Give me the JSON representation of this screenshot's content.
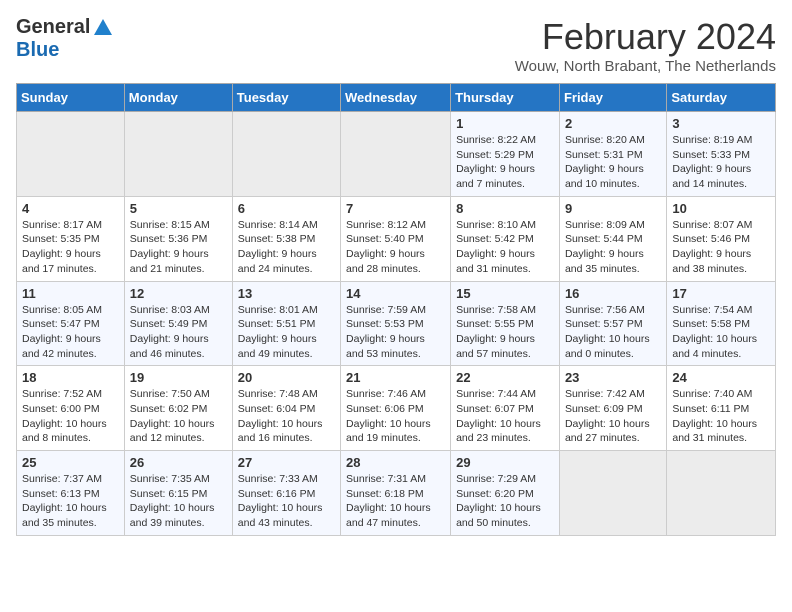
{
  "header": {
    "logo_general": "General",
    "logo_blue": "Blue",
    "month_title": "February 2024",
    "subtitle": "Wouw, North Brabant, The Netherlands"
  },
  "days_of_week": [
    "Sunday",
    "Monday",
    "Tuesday",
    "Wednesday",
    "Thursday",
    "Friday",
    "Saturday"
  ],
  "weeks": [
    [
      {
        "day": "",
        "info": ""
      },
      {
        "day": "",
        "info": ""
      },
      {
        "day": "",
        "info": ""
      },
      {
        "day": "",
        "info": ""
      },
      {
        "day": "1",
        "info": "Sunrise: 8:22 AM\nSunset: 5:29 PM\nDaylight: 9 hours and 7 minutes."
      },
      {
        "day": "2",
        "info": "Sunrise: 8:20 AM\nSunset: 5:31 PM\nDaylight: 9 hours and 10 minutes."
      },
      {
        "day": "3",
        "info": "Sunrise: 8:19 AM\nSunset: 5:33 PM\nDaylight: 9 hours and 14 minutes."
      }
    ],
    [
      {
        "day": "4",
        "info": "Sunrise: 8:17 AM\nSunset: 5:35 PM\nDaylight: 9 hours and 17 minutes."
      },
      {
        "day": "5",
        "info": "Sunrise: 8:15 AM\nSunset: 5:36 PM\nDaylight: 9 hours and 21 minutes."
      },
      {
        "day": "6",
        "info": "Sunrise: 8:14 AM\nSunset: 5:38 PM\nDaylight: 9 hours and 24 minutes."
      },
      {
        "day": "7",
        "info": "Sunrise: 8:12 AM\nSunset: 5:40 PM\nDaylight: 9 hours and 28 minutes."
      },
      {
        "day": "8",
        "info": "Sunrise: 8:10 AM\nSunset: 5:42 PM\nDaylight: 9 hours and 31 minutes."
      },
      {
        "day": "9",
        "info": "Sunrise: 8:09 AM\nSunset: 5:44 PM\nDaylight: 9 hours and 35 minutes."
      },
      {
        "day": "10",
        "info": "Sunrise: 8:07 AM\nSunset: 5:46 PM\nDaylight: 9 hours and 38 minutes."
      }
    ],
    [
      {
        "day": "11",
        "info": "Sunrise: 8:05 AM\nSunset: 5:47 PM\nDaylight: 9 hours and 42 minutes."
      },
      {
        "day": "12",
        "info": "Sunrise: 8:03 AM\nSunset: 5:49 PM\nDaylight: 9 hours and 46 minutes."
      },
      {
        "day": "13",
        "info": "Sunrise: 8:01 AM\nSunset: 5:51 PM\nDaylight: 9 hours and 49 minutes."
      },
      {
        "day": "14",
        "info": "Sunrise: 7:59 AM\nSunset: 5:53 PM\nDaylight: 9 hours and 53 minutes."
      },
      {
        "day": "15",
        "info": "Sunrise: 7:58 AM\nSunset: 5:55 PM\nDaylight: 9 hours and 57 minutes."
      },
      {
        "day": "16",
        "info": "Sunrise: 7:56 AM\nSunset: 5:57 PM\nDaylight: 10 hours and 0 minutes."
      },
      {
        "day": "17",
        "info": "Sunrise: 7:54 AM\nSunset: 5:58 PM\nDaylight: 10 hours and 4 minutes."
      }
    ],
    [
      {
        "day": "18",
        "info": "Sunrise: 7:52 AM\nSunset: 6:00 PM\nDaylight: 10 hours and 8 minutes."
      },
      {
        "day": "19",
        "info": "Sunrise: 7:50 AM\nSunset: 6:02 PM\nDaylight: 10 hours and 12 minutes."
      },
      {
        "day": "20",
        "info": "Sunrise: 7:48 AM\nSunset: 6:04 PM\nDaylight: 10 hours and 16 minutes."
      },
      {
        "day": "21",
        "info": "Sunrise: 7:46 AM\nSunset: 6:06 PM\nDaylight: 10 hours and 19 minutes."
      },
      {
        "day": "22",
        "info": "Sunrise: 7:44 AM\nSunset: 6:07 PM\nDaylight: 10 hours and 23 minutes."
      },
      {
        "day": "23",
        "info": "Sunrise: 7:42 AM\nSunset: 6:09 PM\nDaylight: 10 hours and 27 minutes."
      },
      {
        "day": "24",
        "info": "Sunrise: 7:40 AM\nSunset: 6:11 PM\nDaylight: 10 hours and 31 minutes."
      }
    ],
    [
      {
        "day": "25",
        "info": "Sunrise: 7:37 AM\nSunset: 6:13 PM\nDaylight: 10 hours and 35 minutes."
      },
      {
        "day": "26",
        "info": "Sunrise: 7:35 AM\nSunset: 6:15 PM\nDaylight: 10 hours and 39 minutes."
      },
      {
        "day": "27",
        "info": "Sunrise: 7:33 AM\nSunset: 6:16 PM\nDaylight: 10 hours and 43 minutes."
      },
      {
        "day": "28",
        "info": "Sunrise: 7:31 AM\nSunset: 6:18 PM\nDaylight: 10 hours and 47 minutes."
      },
      {
        "day": "29",
        "info": "Sunrise: 7:29 AM\nSunset: 6:20 PM\nDaylight: 10 hours and 50 minutes."
      },
      {
        "day": "",
        "info": ""
      },
      {
        "day": "",
        "info": ""
      }
    ]
  ]
}
